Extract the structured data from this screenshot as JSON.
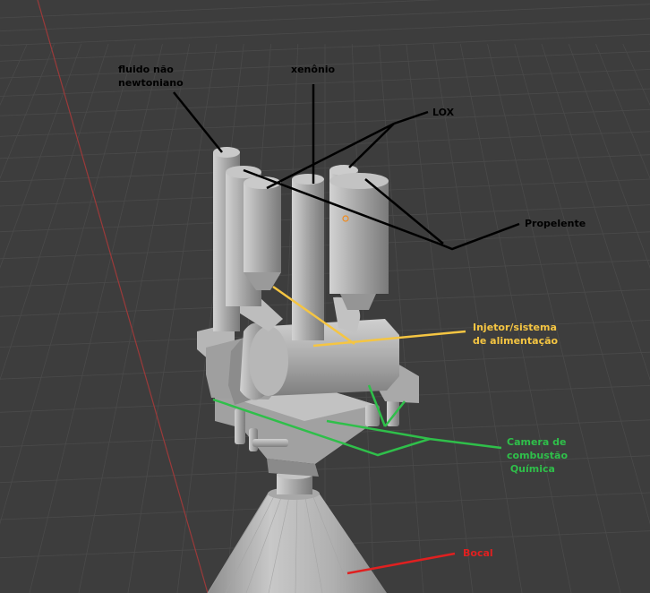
{
  "viewport": {
    "background": "#3d3d3d",
    "grid_color": "#4a4a4a",
    "x_axis_color": "#9b3a3a",
    "object_color": "#b9b9b9",
    "origin_marker_color": "#f08a1c"
  },
  "annotations": [
    {
      "id": "fluido",
      "text": "fluido não\nnewtoniano",
      "color": "#000000"
    },
    {
      "id": "xenonio",
      "text": "xenônio",
      "color": "#000000"
    },
    {
      "id": "lox",
      "text": "LOX",
      "color": "#000000"
    },
    {
      "id": "propelente",
      "text": "Propelente",
      "color": "#000000"
    },
    {
      "id": "injetor",
      "text": "Injetor/sistema\nde alimentação",
      "color": "#f5c542"
    },
    {
      "id": "camera",
      "text": "Camera de\ncombustão\n Química",
      "color": "#2fbf4a"
    },
    {
      "id": "bocal",
      "text": "Bocal",
      "color": "#e02020"
    }
  ]
}
